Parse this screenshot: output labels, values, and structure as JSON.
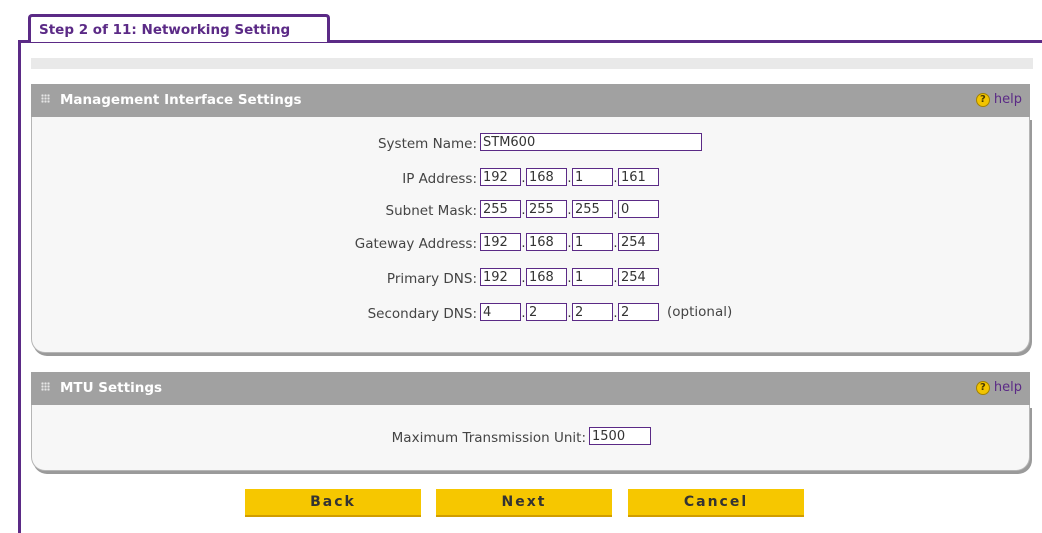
{
  "step_tab": {
    "label": "Step 2 of 11: Networking Setting"
  },
  "sections": {
    "management": {
      "title": "Management Interface Settings",
      "help_label": "help",
      "fields": {
        "system_name": {
          "label": "System Name:",
          "value": "STM600"
        },
        "ip_address": {
          "label": "IP Address:",
          "octets": [
            "192",
            "168",
            "1",
            "161"
          ]
        },
        "subnet_mask": {
          "label": "Subnet Mask:",
          "octets": [
            "255",
            "255",
            "255",
            "0"
          ]
        },
        "gateway_address": {
          "label": "Gateway Address:",
          "octets": [
            "192",
            "168",
            "1",
            "254"
          ]
        },
        "primary_dns": {
          "label": "Primary DNS:",
          "octets": [
            "192",
            "168",
            "1",
            "254"
          ]
        },
        "secondary_dns": {
          "label": "Secondary DNS:",
          "octets": [
            "4",
            "2",
            "2",
            "2"
          ],
          "note": "(optional)"
        }
      }
    },
    "mtu": {
      "title": "MTU Settings",
      "help_label": "help",
      "field": {
        "label": "Maximum Transmission Unit:",
        "value": "1500"
      }
    }
  },
  "buttons": {
    "back": "Back",
    "next": "Next",
    "cancel": "Cancel"
  },
  "colors": {
    "accent_purple": "#5b2a86",
    "section_bar": "#a1a1a1",
    "button_yellow": "#f6c700",
    "help_icon": "#f2c400"
  }
}
